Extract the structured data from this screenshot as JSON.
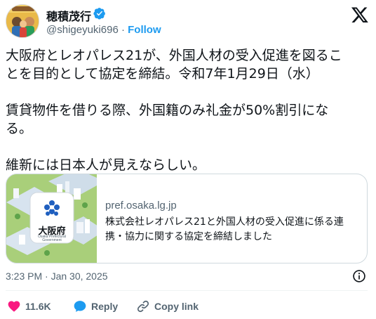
{
  "author": {
    "name": "穂積茂行",
    "handle": "@shigeyuki696",
    "separator": "·",
    "follow_label": "Follow"
  },
  "icons": {
    "verified": "verified-badge-icon",
    "platform": "x-logo-icon",
    "info": "info-icon",
    "like": "heart-icon",
    "reply": "reply-bubble-icon",
    "copy": "link-icon"
  },
  "tweet": {
    "paragraph1_line1": "大阪府とレオパレス21が、外国人材の受入促進を図るこ",
    "paragraph1_line2": "とを目的として協定を締結。令和7年1月29日（水）",
    "paragraph2_line1": "賃貸物件を借りる際、外国籍のみ礼金が50%割引にな",
    "paragraph2_line2": "る。",
    "paragraph3": "維新には日本人が見えならしい。"
  },
  "card": {
    "thumb_label_main": "大阪府",
    "thumb_label_sub1": "Osaka Prefectural",
    "thumb_label_sub2": "Government",
    "domain": "pref.osaka.lg.jp",
    "title_line1": "株式会社レオパレス21と外国人材の受入促進に係る連",
    "title_line2": "携・協力に関する協定を締結しました"
  },
  "meta": {
    "timestamp": "3:23 PM · Jan 30, 2025"
  },
  "actions": {
    "like_count": "11.6K",
    "reply_label": "Reply",
    "copy_label": "Copy link"
  },
  "colors": {
    "accent": "#1d9bf0",
    "like": "#f91880",
    "secondary_text": "#536471",
    "text": "#0f1419"
  }
}
